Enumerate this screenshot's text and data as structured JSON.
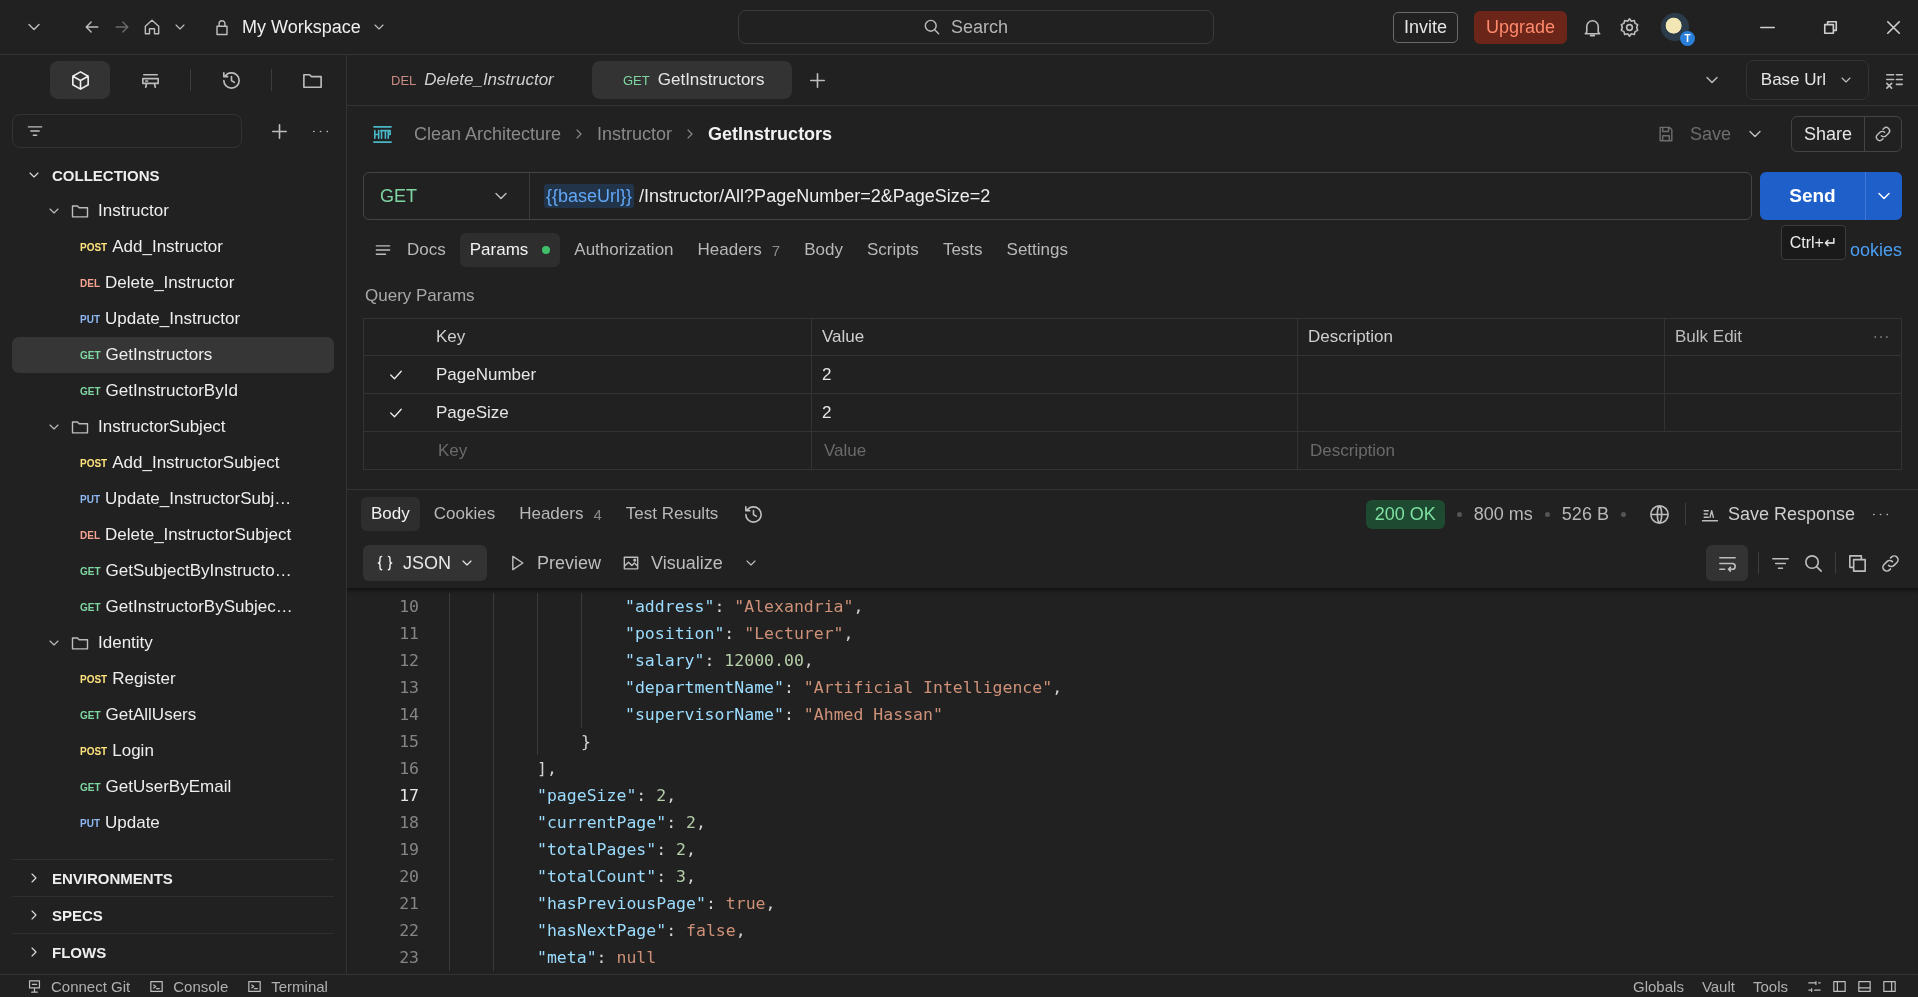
{
  "topbar": {
    "workspace": "My Workspace",
    "search": {
      "placeholder": "Search"
    },
    "invite": "Invite",
    "upgrade": "Upgrade",
    "avatar_badge": "T"
  },
  "sidebar": {
    "tabs": [
      {
        "selected": true
      },
      {
        "selected": false
      },
      {
        "selected": false
      },
      {
        "selected": false
      }
    ],
    "sections": [
      {
        "title": "COLLECTIONS",
        "expanded": true,
        "children": [
          {
            "name": "Instructor",
            "expanded": true,
            "children": [
              {
                "method": "POST",
                "color": "#ffe47e",
                "name": "Add_Instructor",
                "selected": false
              },
              {
                "method": "DEL",
                "color": "#f7a394",
                "name": "Delete_Instructor",
                "selected": false
              },
              {
                "method": "PUT",
                "color": "#8fb8f7",
                "name": "Update_Instructor",
                "selected": false
              },
              {
                "method": "GET",
                "color": "#7fd6a3",
                "name": "GetInstructors",
                "selected": true
              },
              {
                "method": "GET",
                "color": "#7fd6a3",
                "name": "GetInstructorById",
                "selected": false
              }
            ]
          },
          {
            "name": "InstructorSubject",
            "expanded": true,
            "children": [
              {
                "method": "POST",
                "color": "#ffe47e",
                "name": "Add_InstructorSubject",
                "selected": false
              },
              {
                "method": "PUT",
                "color": "#8fb8f7",
                "name": "Update_InstructorSubj…",
                "selected": false
              },
              {
                "method": "DEL",
                "color": "#f7a394",
                "name": "Delete_InstructorSubject",
                "selected": false
              },
              {
                "method": "GET",
                "color": "#7fd6a3",
                "name": "GetSubjectByInstructo…",
                "selected": false
              },
              {
                "method": "GET",
                "color": "#7fd6a3",
                "name": "GetInstructorBySubjec…",
                "selected": false
              }
            ]
          },
          {
            "name": "Identity",
            "expanded": true,
            "children": [
              {
                "method": "POST",
                "color": "#ffe47e",
                "name": "Register",
                "selected": false
              },
              {
                "method": "GET",
                "color": "#7fd6a3",
                "name": "GetAllUsers",
                "selected": false
              },
              {
                "method": "POST",
                "color": "#ffe47e",
                "name": "Login",
                "selected": false
              },
              {
                "method": "GET",
                "color": "#7fd6a3",
                "name": "GetUserByEmail",
                "selected": false
              },
              {
                "method": "PUT",
                "color": "#8fb8f7",
                "name": "Update",
                "selected": false
              }
            ]
          }
        ]
      },
      {
        "title": "ENVIRONMENTS",
        "expanded": false
      },
      {
        "title": "SPECS",
        "expanded": false
      },
      {
        "title": "FLOWS",
        "expanded": false
      }
    ]
  },
  "tabs": [
    {
      "method": "DEL",
      "color": "#c98a82",
      "name": "Delete_Instructor",
      "preview": true,
      "selected": false
    },
    {
      "method": "GET",
      "color": "#7fd6a3",
      "name": "GetInstructors",
      "preview": false,
      "selected": true
    }
  ],
  "environment": "Base Url",
  "breadcrumb": [
    {
      "label": "Clean Architecture",
      "selected": false
    },
    {
      "label": "Instructor",
      "selected": false
    },
    {
      "label": "GetInstructors",
      "selected": true
    }
  ],
  "save": "Save",
  "share": "Share",
  "request": {
    "method": "GET",
    "color": "#7fd6a3",
    "url_variable": "{{baseUrl}}",
    "url_path": "/Instructor/All?PageNumber=2&PageSize=2",
    "send": "Send",
    "tooltip": "Ctrl+↵",
    "cookies_link": "ookies"
  },
  "request_tabs": [
    {
      "label": "Docs",
      "selected": false
    },
    {
      "label": "Params",
      "selected": true,
      "dot": true
    },
    {
      "label": "Authorization",
      "selected": false
    },
    {
      "label": "Headers",
      "count": "7",
      "selected": false
    },
    {
      "label": "Body",
      "selected": false
    },
    {
      "label": "Scripts",
      "selected": false
    },
    {
      "label": "Tests",
      "selected": false
    },
    {
      "label": "Settings",
      "selected": false
    }
  ],
  "query_params": {
    "title": "Query Params",
    "columns": [
      "Key",
      "Value",
      "Description"
    ],
    "bulk_edit": "Bulk Edit",
    "rows": [
      {
        "checked": true,
        "key": "PageNumber",
        "value": "2"
      },
      {
        "checked": true,
        "key": "PageSize",
        "value": "2"
      }
    ],
    "new_row": {
      "key": {
        "placeholder": "Key"
      },
      "value": {
        "placeholder": "Value"
      },
      "description": {
        "placeholder": "Description"
      }
    }
  },
  "response_tabs": [
    {
      "label": "Body",
      "selected": true
    },
    {
      "label": "Cookies",
      "selected": false
    },
    {
      "label": "Headers",
      "count": "4",
      "selected": false
    },
    {
      "label": "Test Results",
      "selected": false
    }
  ],
  "status": "200 OK",
  "time": "800 ms",
  "size": "526 B",
  "save_response": "Save Response",
  "format": "JSON",
  "preview": "Preview",
  "visualize": "Visualize",
  "code": {
    "items": [
      {
        "kind": "group",
        "children": [
          {
            "kind": "group",
            "children": [
              {
                "kind": "line",
                "number": "10",
                "current": false,
                "tokens": [
                  {
                    "kind": "key",
                    "t": "\"address\""
                  },
                  {
                    "kind": "punct",
                    "t": ": "
                  },
                  {
                    "kind": "str",
                    "t": "\"Alexandria\""
                  },
                  {
                    "kind": "punct",
                    "t": ","
                  }
                ]
              },
              {
                "kind": "line",
                "number": "11",
                "current": false,
                "tokens": [
                  {
                    "kind": "key",
                    "t": "\"position\""
                  },
                  {
                    "kind": "punct",
                    "t": ": "
                  },
                  {
                    "kind": "str",
                    "t": "\"Lecturer\""
                  },
                  {
                    "kind": "punct",
                    "t": ","
                  }
                ]
              },
              {
                "kind": "line",
                "number": "12",
                "current": false,
                "tokens": [
                  {
                    "kind": "key",
                    "t": "\"salary\""
                  },
                  {
                    "kind": "punct",
                    "t": ": "
                  },
                  {
                    "kind": "num",
                    "t": "12000.00"
                  },
                  {
                    "kind": "punct",
                    "t": ","
                  }
                ]
              },
              {
                "kind": "line",
                "number": "13",
                "current": false,
                "tokens": [
                  {
                    "kind": "key",
                    "t": "\"departmentName\""
                  },
                  {
                    "kind": "punct",
                    "t": ": "
                  },
                  {
                    "kind": "str",
                    "t": "\"Artificial Intelligence\""
                  },
                  {
                    "kind": "punct",
                    "t": ","
                  }
                ]
              },
              {
                "kind": "line",
                "number": "14",
                "current": false,
                "tokens": [
                  {
                    "kind": "key",
                    "t": "\"supervisorName\""
                  },
                  {
                    "kind": "punct",
                    "t": ": "
                  },
                  {
                    "kind": "str",
                    "t": "\"Ahmed Hassan\""
                  }
                ]
              }
            ]
          },
          {
            "kind": "line",
            "number": "15",
            "current": false,
            "tokens": [
              {
                "kind": "punct",
                "t": "}"
              }
            ]
          }
        ]
      },
      {
        "kind": "line",
        "number": "16",
        "current": false,
        "tokens": [
          {
            "kind": "punct",
            "t": "],"
          }
        ]
      },
      {
        "kind": "line",
        "number": "17",
        "current": true,
        "tokens": [
          {
            "kind": "key",
            "t": "\"pageSize\""
          },
          {
            "kind": "punct",
            "t": ": "
          },
          {
            "kind": "num",
            "t": "2"
          },
          {
            "kind": "punct",
            "t": ","
          }
        ]
      },
      {
        "kind": "line",
        "number": "18",
        "current": false,
        "tokens": [
          {
            "kind": "key",
            "t": "\"currentPage\""
          },
          {
            "kind": "punct",
            "t": ": "
          },
          {
            "kind": "num",
            "t": "2"
          },
          {
            "kind": "punct",
            "t": ","
          }
        ]
      },
      {
        "kind": "line",
        "number": "19",
        "current": false,
        "tokens": [
          {
            "kind": "key",
            "t": "\"totalPages\""
          },
          {
            "kind": "punct",
            "t": ": "
          },
          {
            "kind": "num",
            "t": "2"
          },
          {
            "kind": "punct",
            "t": ","
          }
        ]
      },
      {
        "kind": "line",
        "number": "20",
        "current": false,
        "tokens": [
          {
            "kind": "key",
            "t": "\"totalCount\""
          },
          {
            "kind": "punct",
            "t": ": "
          },
          {
            "kind": "num",
            "t": "3"
          },
          {
            "kind": "punct",
            "t": ","
          }
        ]
      },
      {
        "kind": "line",
        "number": "21",
        "current": false,
        "tokens": [
          {
            "kind": "key",
            "t": "\"hasPreviousPage\""
          },
          {
            "kind": "punct",
            "t": ": "
          },
          {
            "kind": "lit",
            "t": "true"
          },
          {
            "kind": "punct",
            "t": ","
          }
        ]
      },
      {
        "kind": "line",
        "number": "22",
        "current": false,
        "tokens": [
          {
            "kind": "key",
            "t": "\"hasNextPage\""
          },
          {
            "kind": "punct",
            "t": ": "
          },
          {
            "kind": "lit",
            "t": "false"
          },
          {
            "kind": "punct",
            "t": ","
          }
        ]
      },
      {
        "kind": "line",
        "number": "23",
        "current": false,
        "tokens": [
          {
            "kind": "key",
            "t": "\"meta\""
          },
          {
            "kind": "punct",
            "t": ": "
          },
          {
            "kind": "lit",
            "t": "null"
          }
        ]
      }
    ]
  },
  "status_bar": {
    "left": [
      "Connect Git",
      "Console",
      "Terminal"
    ],
    "right": [
      "Globals",
      "Vault",
      "Tools"
    ]
  }
}
